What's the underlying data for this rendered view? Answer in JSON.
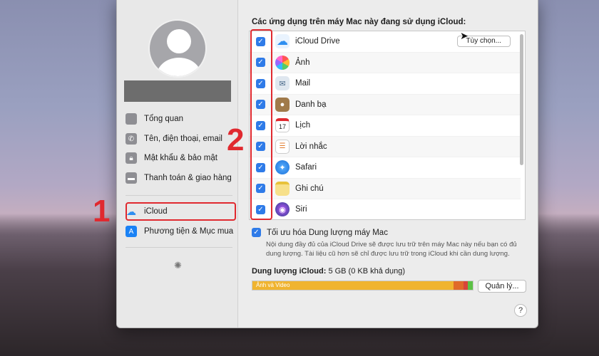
{
  "sidebar": {
    "items": [
      {
        "label": "Tổng quan",
        "icon": "apple-icon"
      },
      {
        "label": "Tên, điện thoại, email",
        "icon": "phone-icon"
      },
      {
        "label": "Mật khẩu & bảo mật",
        "icon": "lock-icon"
      },
      {
        "label": "Thanh toán & giao hàng",
        "icon": "card-icon"
      },
      {
        "label": "iCloud",
        "icon": "icloud-icon",
        "selected": true
      },
      {
        "label": "Phương tiện & Mục mua",
        "icon": "appstore-icon"
      }
    ]
  },
  "main": {
    "heading": "Các ứng dụng trên máy Mac này đang sử dụng iCloud:",
    "apps": [
      {
        "label": "iCloud Drive",
        "checked": true,
        "icon": "icloud-drive-icon"
      },
      {
        "label": "Ảnh",
        "checked": true,
        "icon": "photos-icon"
      },
      {
        "label": "Mail",
        "checked": true,
        "icon": "mail-icon"
      },
      {
        "label": "Danh bạ",
        "checked": true,
        "icon": "contacts-icon"
      },
      {
        "label": "Lịch",
        "checked": true,
        "icon": "calendar-icon"
      },
      {
        "label": "Lời nhắc",
        "checked": true,
        "icon": "reminders-icon"
      },
      {
        "label": "Safari",
        "checked": true,
        "icon": "safari-icon"
      },
      {
        "label": "Ghi chú",
        "checked": true,
        "icon": "notes-icon"
      },
      {
        "label": "Siri",
        "checked": true,
        "icon": "siri-icon"
      }
    ],
    "options_button": "Tùy chọn...",
    "calendar_day": "17",
    "optimize_label": "Tối ưu hóa Dung lượng máy Mac",
    "optimize_checked": true,
    "optimize_desc": "Nội dung đầy đủ của iCloud Drive sẽ được lưu trữ trên máy Mac này nếu bạn có đủ dung lượng. Tài liệu cũ hơn sẽ chỉ được lưu trữ trong iCloud khi cần dung lượng.",
    "storage_title": "Dung lượng iCloud:",
    "storage_value": "5 GB (0 KB khả dụng)",
    "storage_bar_label": "Ảnh và Video",
    "manage_button": "Quản lý...",
    "help_button": "?"
  },
  "annotations": {
    "marker1": "1",
    "marker2": "2"
  },
  "colors": {
    "accent": "#2f7be8",
    "annotation": "#e0292f",
    "storage_photos": "#f0b430",
    "storage_other": "#e06a2a",
    "storage_green": "#5cc146"
  }
}
